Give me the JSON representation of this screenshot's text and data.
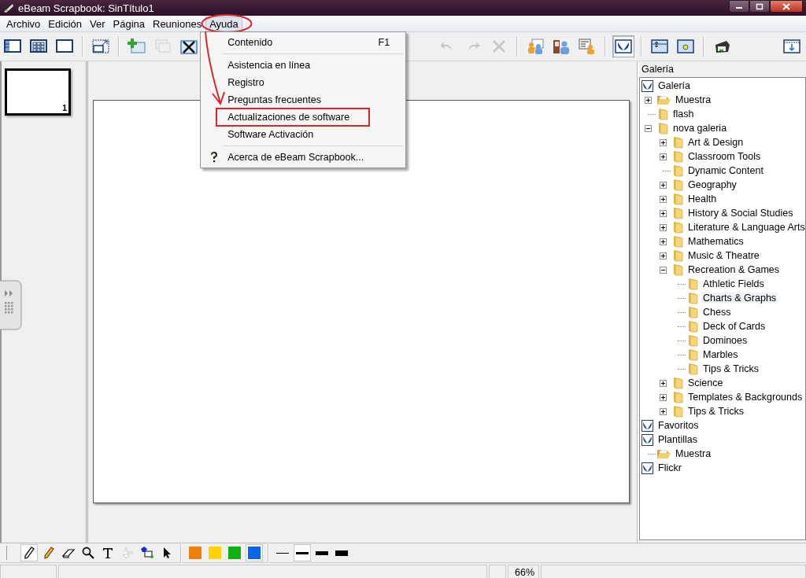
{
  "window": {
    "title": "eBeam Scrapbook: SinTítulo1"
  },
  "menu_bar": [
    {
      "label": "Archivo",
      "selected": false,
      "annotated": false
    },
    {
      "label": "Edición",
      "selected": false,
      "annotated": false
    },
    {
      "label": "Ver",
      "selected": false,
      "annotated": false
    },
    {
      "label": "Página",
      "selected": false,
      "annotated": false
    },
    {
      "label": "Reuniones",
      "selected": false,
      "annotated": false
    },
    {
      "label": "Ayuda",
      "selected": true,
      "annotated": true
    }
  ],
  "open_menu": {
    "callout_arrow": true,
    "items": [
      {
        "kind": "item",
        "label": "Contenido",
        "shortcut": "F1",
        "annotated": false,
        "has_icon": false
      },
      {
        "kind": "separator"
      },
      {
        "kind": "item",
        "label": "Asistencia en línea",
        "annotated": false,
        "has_icon": false
      },
      {
        "kind": "item",
        "label": "Registro",
        "annotated": false,
        "has_icon": false
      },
      {
        "kind": "item",
        "label": "Preguntas frecuentes",
        "annotated": false,
        "has_icon": false
      },
      {
        "kind": "item",
        "label": "Actualizaciones de software",
        "annotated": true,
        "has_icon": false
      },
      {
        "kind": "item",
        "label": "Software Activación",
        "annotated": false,
        "has_icon": false
      },
      {
        "kind": "separator"
      },
      {
        "kind": "item",
        "label": "Acerca de eBeam Scrapbook...",
        "annotated": false,
        "has_icon": true
      }
    ]
  },
  "toolbar": {
    "left_buttons": [
      {
        "kind": "page-list",
        "disabled": false,
        "pressed": false
      },
      {
        "kind": "grid-view",
        "disabled": false,
        "pressed": false
      },
      {
        "kind": "single-page",
        "disabled": false,
        "pressed": false
      },
      {
        "kind": "separator"
      },
      {
        "kind": "resize",
        "disabled": false,
        "pressed": false
      },
      {
        "kind": "separator"
      },
      {
        "kind": "add-page",
        "disabled": false,
        "pressed": false
      },
      {
        "kind": "duplicate-page",
        "disabled": true,
        "pressed": false
      },
      {
        "kind": "delete-page",
        "disabled": false,
        "pressed": false
      }
    ],
    "middle_buttons": [
      {
        "kind": "undo",
        "disabled": true,
        "pressed": false
      },
      {
        "kind": "redo",
        "disabled": true,
        "pressed": false
      },
      {
        "kind": "clear",
        "disabled": true,
        "pressed": false
      },
      {
        "kind": "separator"
      },
      {
        "kind": "person-board",
        "disabled": false,
        "pressed": false
      },
      {
        "kind": "person-door",
        "disabled": false,
        "pressed": false
      },
      {
        "kind": "person-list",
        "disabled": false,
        "pressed": false
      },
      {
        "kind": "separator"
      },
      {
        "kind": "butterfly",
        "disabled": false,
        "pressed": true
      },
      {
        "kind": "separator"
      },
      {
        "kind": "frame-arrows",
        "disabled": false,
        "pressed": false
      },
      {
        "kind": "frame-dot",
        "disabled": false,
        "pressed": false
      },
      {
        "kind": "separator"
      },
      {
        "kind": "projector",
        "disabled": false,
        "pressed": false
      }
    ],
    "right_buttons": [
      {
        "kind": "download-frame",
        "disabled": false,
        "pressed": false
      }
    ]
  },
  "pages": [
    {
      "number": "1",
      "selected": true
    }
  ],
  "gallery": {
    "title": "Galería",
    "tree": [
      {
        "label": "Galería",
        "kind": "root",
        "selected": false,
        "children": [
          {
            "label": "Muestra",
            "kind": "open-folder",
            "expanded": false,
            "selected": false
          },
          {
            "label": "flash",
            "kind": "folder",
            "selected": false
          },
          {
            "label": "nova galeria",
            "kind": "folder",
            "expanded": true,
            "selected": false,
            "children": [
              {
                "label": "Art & Design",
                "kind": "folder",
                "expanded": false,
                "selected": false
              },
              {
                "label": "Classroom Tools",
                "kind": "folder",
                "expanded": false,
                "selected": false
              },
              {
                "label": "Dynamic Content",
                "kind": "folder",
                "selected": false
              },
              {
                "label": "Geography",
                "kind": "folder",
                "expanded": false,
                "selected": false
              },
              {
                "label": "Health",
                "kind": "folder",
                "expanded": false,
                "selected": false
              },
              {
                "label": "History & Social Studies",
                "kind": "folder",
                "expanded": false,
                "selected": false
              },
              {
                "label": "Literature & Language Arts",
                "kind": "folder",
                "expanded": false,
                "selected": false
              },
              {
                "label": "Mathematics",
                "kind": "folder",
                "expanded": false,
                "selected": false
              },
              {
                "label": "Music & Theatre",
                "kind": "folder",
                "expanded": false,
                "selected": false
              },
              {
                "label": "Recreation & Games",
                "kind": "folder",
                "expanded": true,
                "selected": false,
                "children": [
                  {
                    "label": "Athletic Fields",
                    "kind": "folder",
                    "selected": false
                  },
                  {
                    "label": "Charts & Graphs",
                    "kind": "folder",
                    "selected": true
                  },
                  {
                    "label": "Chess",
                    "kind": "folder",
                    "selected": false
                  },
                  {
                    "label": "Deck of Cards",
                    "kind": "folder",
                    "selected": false
                  },
                  {
                    "label": "Dominoes",
                    "kind": "folder",
                    "selected": false
                  },
                  {
                    "label": "Marbles",
                    "kind": "folder",
                    "selected": false
                  },
                  {
                    "label": "Tips & Tricks",
                    "kind": "folder",
                    "selected": false
                  }
                ]
              },
              {
                "label": "Science",
                "kind": "folder",
                "expanded": false,
                "selected": false
              },
              {
                "label": "Templates & Backgrounds",
                "kind": "folder",
                "expanded": false,
                "selected": false
              },
              {
                "label": "Tips & Tricks",
                "kind": "folder",
                "expanded": false,
                "selected": false
              }
            ]
          }
        ]
      },
      {
        "label": "Favoritos",
        "kind": "root",
        "selected": false
      },
      {
        "label": "Plantillas",
        "kind": "root",
        "selected": false,
        "children": [
          {
            "label": "Muestra",
            "kind": "open-folder",
            "selected": false
          }
        ]
      },
      {
        "label": "Flickr",
        "kind": "root",
        "selected": false
      }
    ]
  },
  "drawing_toolbar": {
    "tools": [
      {
        "kind": "pen",
        "selected": true,
        "disabled": false
      },
      {
        "kind": "highlighter",
        "selected": false,
        "disabled": false
      },
      {
        "kind": "eraser",
        "selected": false,
        "disabled": false
      },
      {
        "kind": "magnifier",
        "selected": false,
        "disabled": false
      },
      {
        "kind": "text",
        "selected": false,
        "disabled": false
      },
      {
        "kind": "hand",
        "selected": false,
        "disabled": true
      },
      {
        "kind": "shapes",
        "selected": false,
        "disabled": false
      },
      {
        "kind": "pointer",
        "selected": false,
        "disabled": false
      }
    ],
    "colors": [
      {
        "color": "#f07f0a",
        "selected": false
      },
      {
        "color": "#ffd200",
        "selected": false
      },
      {
        "color": "#10b010",
        "selected": false
      },
      {
        "color": "#0a64f0",
        "selected": true
      }
    ],
    "line_widths": [
      {
        "kind": "thin",
        "selected": false
      },
      {
        "kind": "medium",
        "selected": true
      },
      {
        "kind": "thick",
        "selected": false
      },
      {
        "kind": "heavy",
        "selected": false
      }
    ]
  },
  "status_bar": {
    "zoom": "66%"
  }
}
